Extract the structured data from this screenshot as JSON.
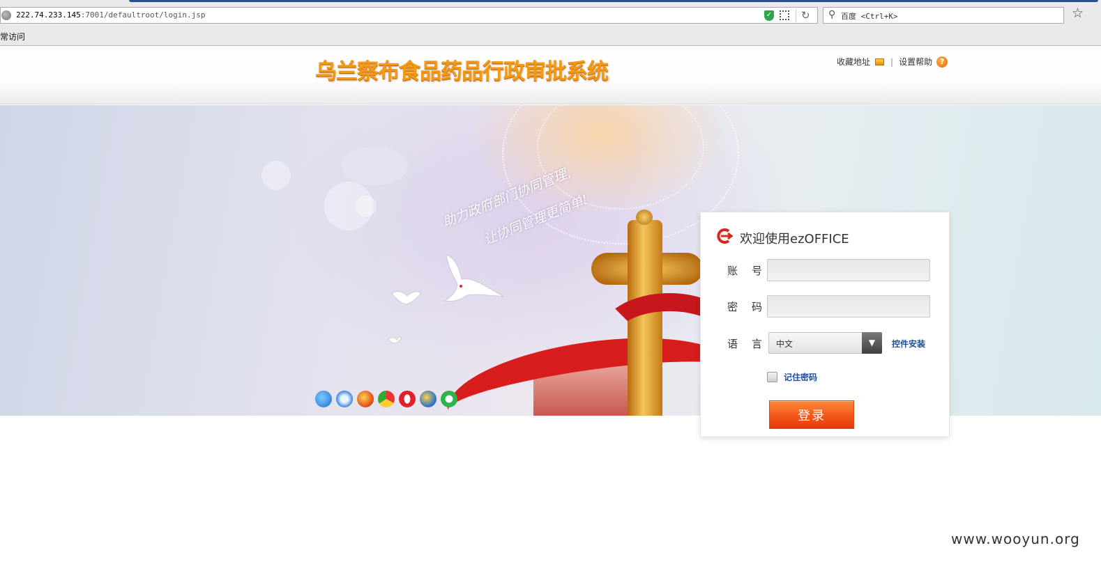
{
  "browser": {
    "url_host": "222.74.233.145",
    "url_path": ":7001/defaultroot/login.jsp",
    "search_placeholder": "百度 <Ctrl+K>",
    "bookmark_label": "常访问"
  },
  "header": {
    "site_title": "乌兰察布食品药品行政审批系统",
    "favorites_label": "收藏地址",
    "divider": "|",
    "help_label": "设置帮助"
  },
  "banner": {
    "slogan_line1": "助力政府部门协同管理,",
    "slogan_line2": "让协同管理更简单!"
  },
  "login": {
    "title": "欢迎使用ezOFFICE",
    "account_label": "账号",
    "password_label": "密码",
    "language_label": "语言",
    "language_value": "中文",
    "install_link": "控件安装",
    "remember_label": "记住密码",
    "submit_label": "登录"
  },
  "watermark": "www.wooyun.org",
  "colors": {
    "title_orange": "#f29a12",
    "link_blue": "#1e4f9c",
    "button_orange": "#f45a1a"
  }
}
